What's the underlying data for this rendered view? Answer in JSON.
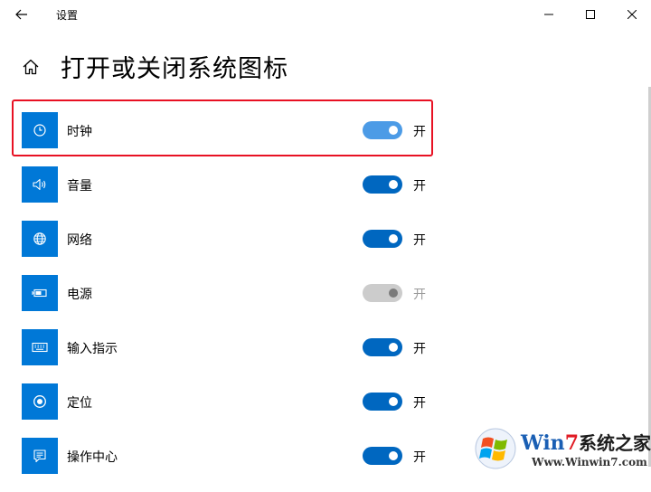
{
  "window": {
    "title": "设置"
  },
  "page": {
    "title": "打开或关闭系统图标"
  },
  "items": [
    {
      "label": "时钟",
      "icon": "clock-icon",
      "state": "开",
      "on": true,
      "enabled": true
    },
    {
      "label": "音量",
      "icon": "volume-icon",
      "state": "开",
      "on": true,
      "enabled": true
    },
    {
      "label": "网络",
      "icon": "globe-icon",
      "state": "开",
      "on": true,
      "enabled": true
    },
    {
      "label": "电源",
      "icon": "battery-icon",
      "state": "开",
      "on": true,
      "enabled": false
    },
    {
      "label": "输入指示",
      "icon": "keyboard-icon",
      "state": "开",
      "on": true,
      "enabled": true
    },
    {
      "label": "定位",
      "icon": "location-icon",
      "state": "开",
      "on": true,
      "enabled": true
    },
    {
      "label": "操作中心",
      "icon": "action-center-icon",
      "state": "开",
      "on": true,
      "enabled": true
    }
  ],
  "watermark": {
    "brand_win": "Win",
    "brand_seven": "7",
    "brand_cn": "系统之家",
    "url": "Www.Winwin7.com"
  },
  "colors": {
    "accent": "#0078d7",
    "toggle_on": "#0067c0",
    "highlight": "#e81123"
  }
}
